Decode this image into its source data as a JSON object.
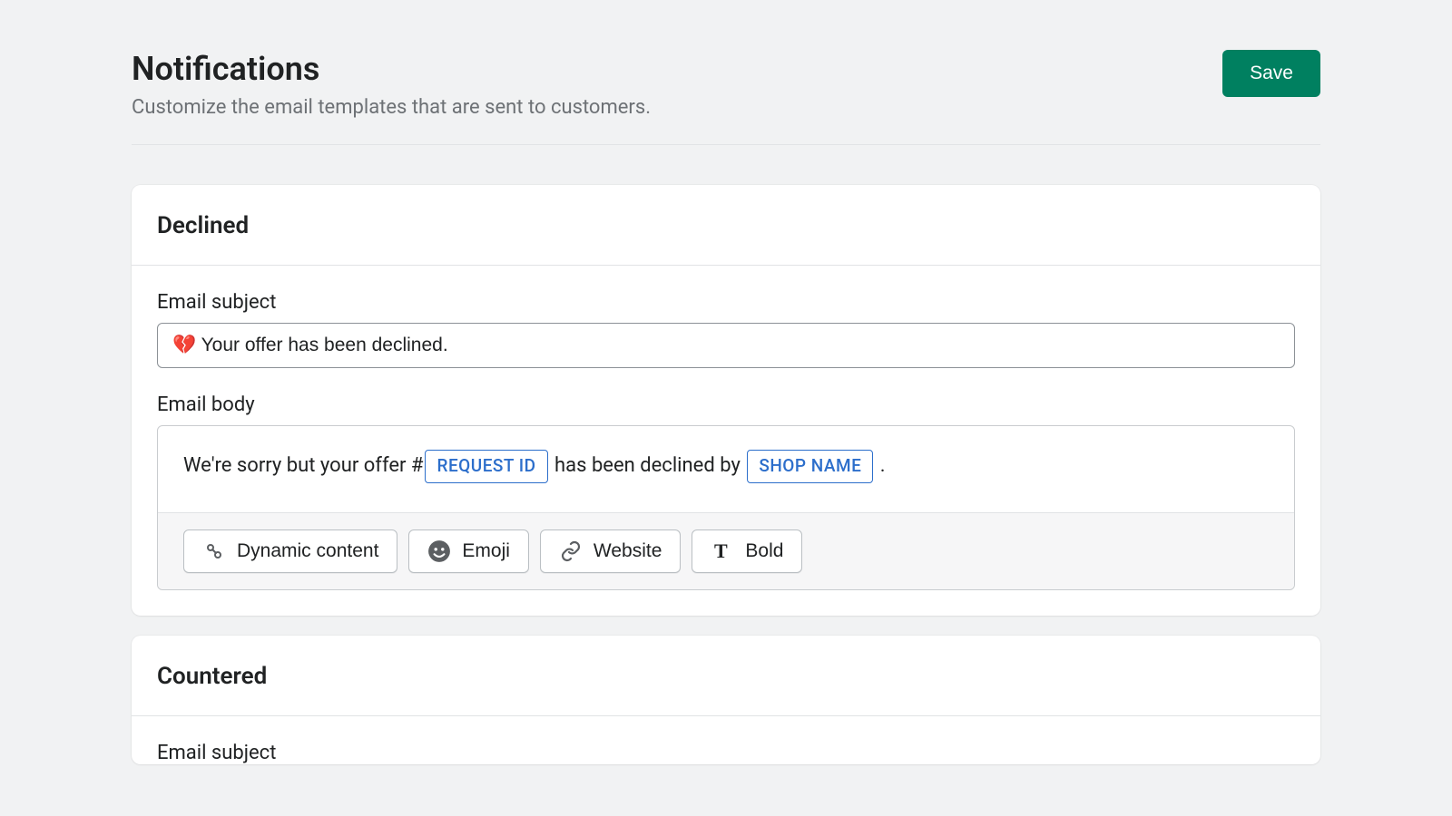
{
  "header": {
    "title": "Notifications",
    "subtitle": "Customize the email templates that are sent to customers.",
    "save_label": "Save"
  },
  "cards": {
    "declined": {
      "title": "Declined",
      "subject_label": "Email subject",
      "subject_value": "💔 Your offer has been declined.",
      "body_label": "Email body",
      "body_text_1": "We're sorry but your offer #",
      "body_token_1": "REQUEST ID",
      "body_text_2": " has been declined by ",
      "body_token_2": "SHOP NAME",
      "body_text_3": " ."
    },
    "countered": {
      "title": "Countered",
      "subject_label": "Email subject"
    }
  },
  "toolbar": {
    "dynamic_content": "Dynamic content",
    "emoji": "Emoji",
    "website": "Website",
    "bold": "Bold"
  }
}
